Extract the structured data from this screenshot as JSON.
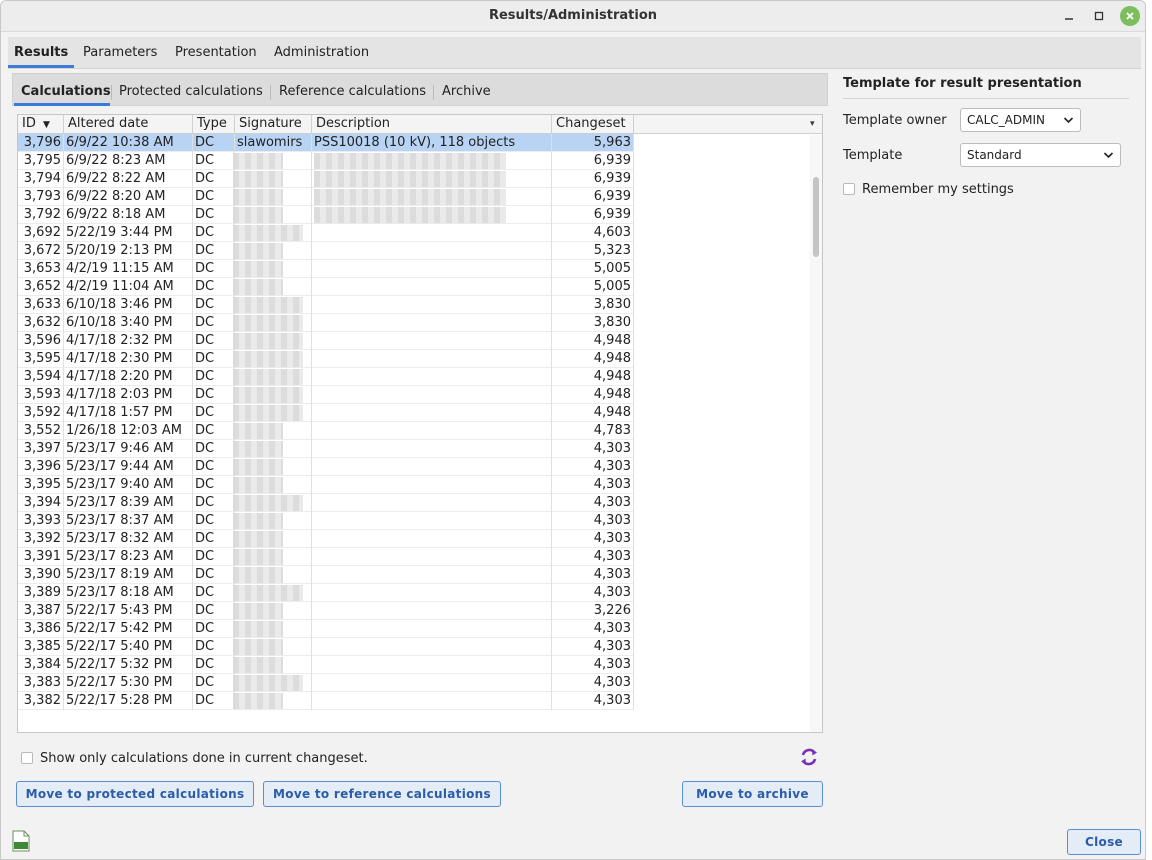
{
  "window": {
    "title": "Results/Administration"
  },
  "main_tabs": [
    {
      "label": "Results"
    },
    {
      "label": "Parameters"
    },
    {
      "label": "Presentation"
    },
    {
      "label": "Administration"
    }
  ],
  "sub_tabs": [
    {
      "label": "Calculations"
    },
    {
      "label": "Protected calculations"
    },
    {
      "label": "Reference calculations"
    },
    {
      "label": "Archive"
    }
  ],
  "table": {
    "columns": [
      "ID",
      "Altered date",
      "Type",
      "Signature",
      "Description",
      "Changeset"
    ],
    "rows": [
      {
        "id": "3,796",
        "date": "6/9/22 10:38 AM",
        "type": "DC",
        "signature": "slawomirs",
        "description": "PSS10018 (10 kV), 118 objects",
        "changeset": "5,963"
      },
      {
        "id": "3,795",
        "date": "6/9/22 8:23 AM",
        "type": "DC",
        "signature": "",
        "description": "",
        "changeset": "6,939"
      },
      {
        "id": "3,794",
        "date": "6/9/22 8:22 AM",
        "type": "DC",
        "signature": "",
        "description": "",
        "changeset": "6,939"
      },
      {
        "id": "3,793",
        "date": "6/9/22 8:20 AM",
        "type": "DC",
        "signature": "",
        "description": "",
        "changeset": "6,939"
      },
      {
        "id": "3,792",
        "date": "6/9/22 8:18 AM",
        "type": "DC",
        "signature": "",
        "description": "",
        "changeset": "6,939"
      },
      {
        "id": "3,692",
        "date": "5/22/19 3:44 PM",
        "type": "DC",
        "signature": "",
        "description": "",
        "changeset": "4,603"
      },
      {
        "id": "3,672",
        "date": "5/20/19 2:13 PM",
        "type": "DC",
        "signature": "",
        "description": "",
        "changeset": "5,323"
      },
      {
        "id": "3,653",
        "date": "4/2/19 11:15 AM",
        "type": "DC",
        "signature": "",
        "description": "",
        "changeset": "5,005"
      },
      {
        "id": "3,652",
        "date": "4/2/19 11:04 AM",
        "type": "DC",
        "signature": "",
        "description": "",
        "changeset": "5,005"
      },
      {
        "id": "3,633",
        "date": "6/10/18 3:46 PM",
        "type": "DC",
        "signature": "",
        "description": "",
        "changeset": "3,830"
      },
      {
        "id": "3,632",
        "date": "6/10/18 3:40 PM",
        "type": "DC",
        "signature": "",
        "description": "",
        "changeset": "3,830"
      },
      {
        "id": "3,596",
        "date": "4/17/18 2:32 PM",
        "type": "DC",
        "signature": "",
        "description": "",
        "changeset": "4,948"
      },
      {
        "id": "3,595",
        "date": "4/17/18 2:30 PM",
        "type": "DC",
        "signature": "",
        "description": "",
        "changeset": "4,948"
      },
      {
        "id": "3,594",
        "date": "4/17/18 2:20 PM",
        "type": "DC",
        "signature": "",
        "description": "",
        "changeset": "4,948"
      },
      {
        "id": "3,593",
        "date": "4/17/18 2:03 PM",
        "type": "DC",
        "signature": "",
        "description": "",
        "changeset": "4,948"
      },
      {
        "id": "3,592",
        "date": "4/17/18 1:57 PM",
        "type": "DC",
        "signature": "",
        "description": "",
        "changeset": "4,948"
      },
      {
        "id": "3,552",
        "date": "1/26/18 12:03 AM",
        "type": "DC",
        "signature": "",
        "description": "",
        "changeset": "4,783"
      },
      {
        "id": "3,397",
        "date": "5/23/17 9:46 AM",
        "type": "DC",
        "signature": "",
        "description": "",
        "changeset": "4,303"
      },
      {
        "id": "3,396",
        "date": "5/23/17 9:44 AM",
        "type": "DC",
        "signature": "",
        "description": "",
        "changeset": "4,303"
      },
      {
        "id": "3,395",
        "date": "5/23/17 9:40 AM",
        "type": "DC",
        "signature": "",
        "description": "",
        "changeset": "4,303"
      },
      {
        "id": "3,394",
        "date": "5/23/17 8:39 AM",
        "type": "DC",
        "signature": "",
        "description": "",
        "changeset": "4,303"
      },
      {
        "id": "3,393",
        "date": "5/23/17 8:37 AM",
        "type": "DC",
        "signature": "",
        "description": "",
        "changeset": "4,303"
      },
      {
        "id": "3,392",
        "date": "5/23/17 8:32 AM",
        "type": "DC",
        "signature": "",
        "description": "",
        "changeset": "4,303"
      },
      {
        "id": "3,391",
        "date": "5/23/17 8:23 AM",
        "type": "DC",
        "signature": "",
        "description": "",
        "changeset": "4,303"
      },
      {
        "id": "3,390",
        "date": "5/23/17 8:19 AM",
        "type": "DC",
        "signature": "",
        "description": "",
        "changeset": "4,303"
      },
      {
        "id": "3,389",
        "date": "5/23/17 8:18 AM",
        "type": "DC",
        "signature": "",
        "description": "",
        "changeset": "4,303"
      },
      {
        "id": "3,387",
        "date": "5/22/17 5:43 PM",
        "type": "DC",
        "signature": "",
        "description": "",
        "changeset": "3,226"
      },
      {
        "id": "3,386",
        "date": "5/22/17 5:42 PM",
        "type": "DC",
        "signature": "",
        "description": "",
        "changeset": "4,303"
      },
      {
        "id": "3,385",
        "date": "5/22/17 5:40 PM",
        "type": "DC",
        "signature": "",
        "description": "",
        "changeset": "4,303"
      },
      {
        "id": "3,384",
        "date": "5/22/17 5:32 PM",
        "type": "DC",
        "signature": "",
        "description": "",
        "changeset": "4,303"
      },
      {
        "id": "3,383",
        "date": "5/22/17 5:30 PM",
        "type": "DC",
        "signature": "",
        "description": "",
        "changeset": "4,303"
      },
      {
        "id": "3,382",
        "date": "5/22/17 5:28 PM",
        "type": "DC",
        "signature": "",
        "description": "",
        "changeset": "4,303"
      }
    ]
  },
  "options": {
    "current_changeset_only": "Show only calculations done in current changeset."
  },
  "buttons": {
    "move_protected": "Move to protected calculations",
    "move_reference": "Move to reference calculations",
    "move_archive": "Move to archive",
    "close": "Close"
  },
  "template_panel": {
    "title": "Template for result presentation",
    "owner_label": "Template owner",
    "owner_value": "CALC_ADMIN",
    "template_label": "Template",
    "template_value": "Standard",
    "remember_label": "Remember my settings"
  },
  "icons": {
    "refresh": "refresh-icon",
    "export": "xls-export-icon",
    "sort": "sort-desc-icon",
    "column_menu": "column-menu-icon"
  },
  "colors": {
    "accent": "#3d7cd6",
    "selection": "#b8d3f3",
    "button_text": "#2a5caa"
  }
}
